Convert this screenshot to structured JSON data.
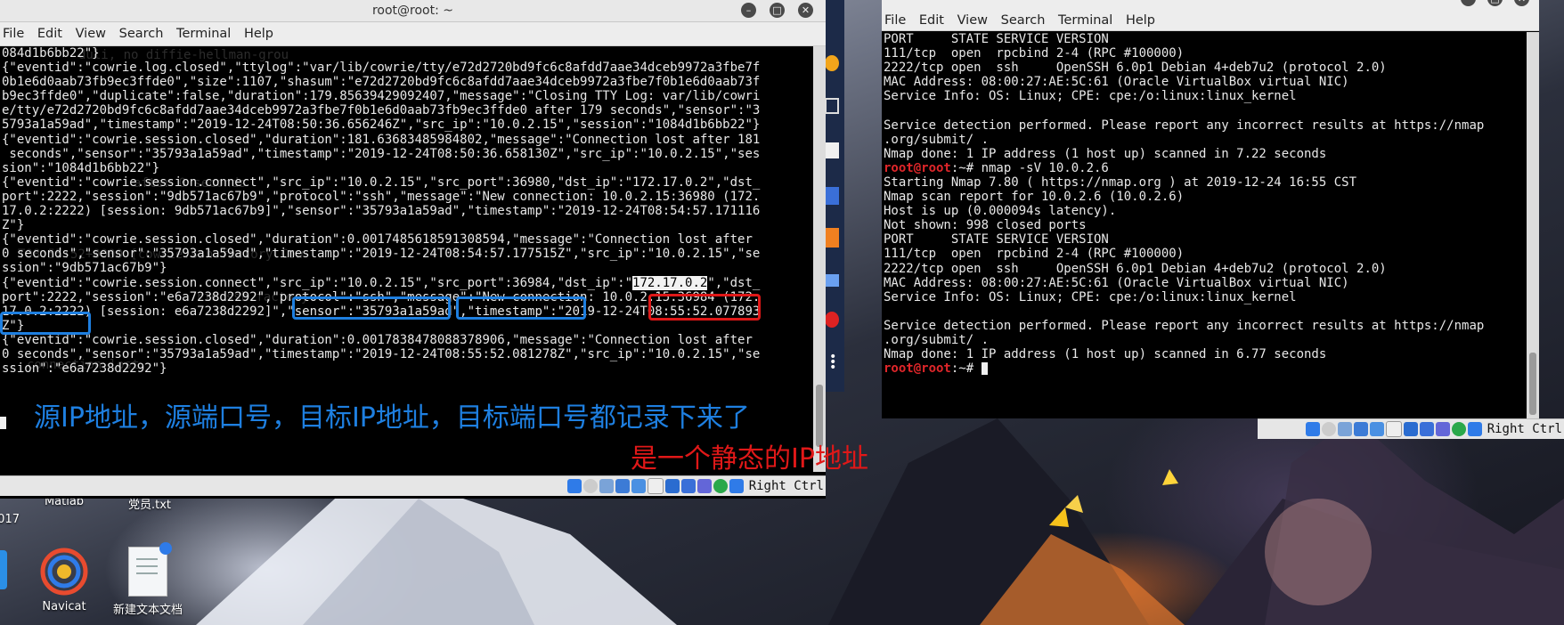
{
  "left_window": {
    "title": "root@root: ~",
    "menu": [
      "File",
      "Edit",
      "View",
      "Search",
      "Terminal",
      "Help"
    ],
    "lines": [
      "084d1b6bb22\"}",
      "{\"eventid\":\"cowrie.log.closed\",\"ttylog\":\"var/lib/cowrie/tty/e72d2720bd9fc6c8afdd7aae34dceb9972a3fbe7f",
      "0b1e6d0aab73fb9ec3ffde0\",\"size\":1107,\"shasum\":\"e72d2720bd9fc6c8afdd7aae34dceb9972a3fbe7f0b1e6d0aab73f",
      "b9ec3ffde0\",\"duplicate\":false,\"duration\":179.85639429092407,\"message\":\"Closing TTY Log: var/lib/cowri",
      "e/tty/e72d2720bd9fc6c8afdd7aae34dceb9972a3fbe7f0b1e6d0aab73fb9ec3ffde0 after 179 seconds\",\"sensor\":\"3",
      "5793a1a59ad\",\"timestamp\":\"2019-12-24T08:50:36.656246Z\",\"src_ip\":\"10.0.2.15\",\"session\":\"1084d1b6bb22\"}",
      "{\"eventid\":\"cowrie.session.closed\",\"duration\":181.63683485984802,\"message\":\"Connection lost after 181",
      " seconds\",\"sensor\":\"35793a1a59ad\",\"timestamp\":\"2019-12-24T08:50:36.658130Z\",\"src_ip\":\"10.0.2.15\",\"ses",
      "sion\":\"1084d1b6bb22\"}",
      "{\"eventid\":\"cowrie.session.connect\",\"src_ip\":\"10.0.2.15\",\"src_port\":36980,\"dst_ip\":\"172.17.0.2\",\"dst_",
      "port\":2222,\"session\":\"9db571ac67b9\",\"protocol\":\"ssh\",\"message\":\"New connection: 10.0.2.15:36980 (172.",
      "17.0.2:2222) [session: 9db571ac67b9]\",\"sensor\":\"35793a1a59ad\",\"timestamp\":\"2019-12-24T08:54:57.171116",
      "Z\"}",
      "{\"eventid\":\"cowrie.session.closed\",\"duration\":0.0017485618591308594,\"message\":\"Connection lost after",
      "0 seconds\",\"sensor\":\"35793a1a59ad\",\"timestamp\":\"2019-12-24T08:54:57.177515Z\",\"src_ip\":\"10.0.2.15\",\"se",
      "ssion\":\"9db571ac67b9\"}",
      "{\"eventid\":\"cowrie.session.connect\",\"src_ip\":\"10.0.2.15\",\"src_port\":36984,\"dst_ip\":\"172.17.0.2\",\"dst_",
      "port\":2222,\"session\":\"e6a7238d2292\",\"protocol\":\"ssh\",\"message\":\"New connection: 10.0.2.15:36984 (172.",
      "17.0.2:2222) [session: e6a7238d2292]\",\"sensor\":\"35793a1a59ad\",\"timestamp\":\"2019-12-24T08:55:52.077893",
      "Z\"}",
      "{\"eventid\":\"cowrie.session.closed\",\"duration\":0.0017838478088378906,\"message\":\"Connection lost after",
      "0 seconds\",\"sensor\":\"35793a1a59ad\",\"timestamp\":\"2019-12-24T08:55:52.081278Z\",\"src_ip\":\"10.0.2.15\",\"se",
      "ssion\":\"e6a7238d2292\"}"
    ],
    "ghost_lines": [
      "duli, no diffie-hellman-grou",
      "after 0 seconds",
      "T08:55:52+0000 [cowrie.ssh.factory.Cow",
      "rie.ssh.factory",
      "connection lost"
    ],
    "selected_text": "172.17.0.2",
    "status_right_ctrl": "Right Ctrl"
  },
  "right_window": {
    "title": "root@root: ~",
    "menu": [
      "File",
      "Edit",
      "View",
      "Search",
      "Terminal",
      "Help"
    ],
    "lines": [
      {
        "t": "PORT     STATE SERVICE VERSION"
      },
      {
        "t": "111/tcp  open  rpcbind 2-4 (RPC #100000)"
      },
      {
        "t": "2222/tcp open  ssh     OpenSSH 6.0p1 Debian 4+deb7u2 (protocol 2.0)"
      },
      {
        "t": "MAC Address: 08:00:27:AE:5C:61 (Oracle VirtualBox virtual NIC)"
      },
      {
        "t": "Service Info: OS: Linux; CPE: cpe:/o:linux:linux_kernel"
      },
      {
        "t": ""
      },
      {
        "t": "Service detection performed. Please report any incorrect results at https://nmap"
      },
      {
        "t": ".org/submit/ ."
      },
      {
        "t": "Nmap done: 1 IP address (1 host up) scanned in 7.22 seconds"
      },
      {
        "p": "root@root",
        "t": ":~# nmap -sV 10.0.2.6"
      },
      {
        "t": "Starting Nmap 7.80 ( https://nmap.org ) at 2019-12-24 16:55 CST"
      },
      {
        "t": "Nmap scan report for 10.0.2.6 (10.0.2.6)"
      },
      {
        "t": "Host is up (0.000094s latency)."
      },
      {
        "t": "Not shown: 998 closed ports"
      },
      {
        "t": "PORT     STATE SERVICE VERSION"
      },
      {
        "t": "111/tcp  open  rpcbind 2-4 (RPC #100000)"
      },
      {
        "t": "2222/tcp open  ssh     OpenSSH 6.0p1 Debian 4+deb7u2 (protocol 2.0)"
      },
      {
        "t": "MAC Address: 08:00:27:AE:5C:61 (Oracle VirtualBox virtual NIC)"
      },
      {
        "t": "Service Info: OS: Linux; CPE: cpe:/o:linux:linux_kernel"
      },
      {
        "t": ""
      },
      {
        "t": "Service detection performed. Please report any incorrect results at https://nmap"
      },
      {
        "t": ".org/submit/ ."
      },
      {
        "t": "Nmap done: 1 IP address (1 host up) scanned in 6.77 seconds"
      },
      {
        "p": "root@root",
        "t": ":~# ",
        "cursor": true
      }
    ],
    "status_right_ctrl": "Right Ctrl"
  },
  "annotations": {
    "blue_caption": "源IP地址，源端口号，目标IP地址，目标端口号都记录下来了",
    "red_caption": "是一个静态的IP地址",
    "blue_color": "#1e7fe0",
    "red_color": "#e01818"
  },
  "desktop": {
    "icons": [
      {
        "label": "Matlab",
        "icon": "matlab-icon"
      },
      {
        "label": "党员.txt",
        "icon": "text-file-icon"
      },
      {
        "label": "017",
        "icon": "folder-icon"
      },
      {
        "label": "Navicat",
        "icon": "navicat-icon"
      },
      {
        "label": "新建文本文档",
        "icon": "text-file-icon"
      }
    ]
  }
}
